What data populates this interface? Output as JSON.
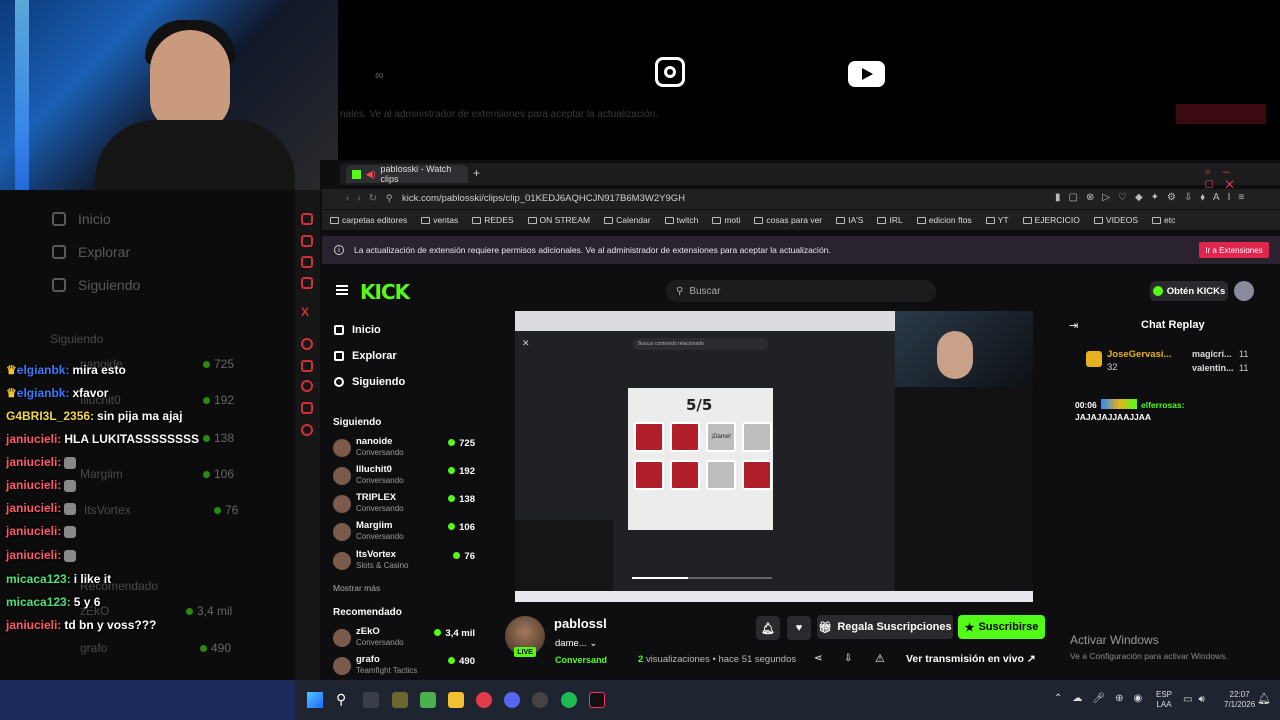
{
  "browser": {
    "tab_title": "pablosski - Watch clips",
    "url": "kick.com/pablosski/clips/clip_01KEDJ6AQHCJN917B6M3W2Y9GH",
    "bookmarks": [
      "carpetas editores",
      "ventas",
      "REDES",
      "ON STREAM",
      "Calendar",
      "twitch",
      "moti",
      "cosas para ver",
      "IA'S",
      "IRL",
      "edicion ftos",
      "YT",
      "EJERCICIO",
      "VIDEOS",
      "etc"
    ],
    "notice_text": "La actualización de extensión requiere permisos adicionales. Ve al administrador de extensiones para aceptar la actualización.",
    "notice_button": "Ir a Extensiones",
    "ghost_notice": "nales. Ve al administrador de extensiones para aceptar la actualización."
  },
  "kick": {
    "search_placeholder": "Buscar",
    "get_kicks": "Obtén KICKs",
    "nav": {
      "home": "Inicio",
      "explore": "Explorar",
      "following": "Siguiendo"
    },
    "following_heading": "Siguiendo",
    "following": [
      {
        "name": "nanoide",
        "status": "Conversando",
        "viewers": "725"
      },
      {
        "name": "Illuchit0",
        "status": "Conversando",
        "viewers": "192"
      },
      {
        "name": "TRIPLEX",
        "status": "Conversando",
        "viewers": "138"
      },
      {
        "name": "Margiim",
        "status": "Conversando",
        "viewers": "106"
      },
      {
        "name": "ItsVortex",
        "status": "Slots & Casino",
        "viewers": "76"
      }
    ],
    "show_more": "Mostrar más",
    "recommended_heading": "Recomendado",
    "recommended": [
      {
        "name": "zEkO",
        "status": "Conversando",
        "viewers": "3,4 mil"
      },
      {
        "name": "grafo",
        "status": "Teamfight Tactics",
        "viewers": "490"
      }
    ],
    "chat_replay_title": "Chat Replay",
    "replay_users": [
      {
        "name": "JoseGervasi...",
        "count": "32"
      },
      {
        "name": "magicri...",
        "count": "11"
      },
      {
        "name": "valentin...",
        "count": "11"
      }
    ],
    "replay_msg": {
      "time": "00:06",
      "user": "elferrosas:",
      "text": "JAJAJAJJAAJJAA"
    },
    "clip": {
      "channel": "pablossl",
      "title": "dame...",
      "category": "Conversand",
      "live_badge": "LIVE",
      "views_count": "2",
      "views_label": "visualizaciones",
      "ago": "hace 51 segundos",
      "gift_button": "Regala Suscripciones",
      "subscribe_button": "Suscribirse",
      "watch_live": "Ver transmisión en vivo"
    },
    "game": {
      "score": "5/5",
      "dame": "¡Dame!"
    },
    "video_search": "Buscar contenido relacionado"
  },
  "left_ghost": {
    "nav": [
      "Inicio",
      "Explorar",
      "Siguiendo"
    ],
    "following_heading": "Siguiendo",
    "items": [
      {
        "name": "nanoide",
        "viewers": "725"
      },
      {
        "name": "Illuchit0",
        "viewers": "192"
      },
      {
        "name": "TRIPLEX",
        "viewers": "138"
      },
      {
        "name": "Margiim",
        "viewers": "106"
      },
      {
        "name": "ItsVortex",
        "viewers": "76"
      },
      {
        "name": "Recomendado",
        "viewers": ""
      },
      {
        "name": "zEkO",
        "viewers": "3,4 mil"
      },
      {
        "name": "grafo",
        "viewers": "490"
      }
    ]
  },
  "chat_overlay": [
    {
      "user": "elgianbk:",
      "text": "mira esto",
      "color": "#3a7bff",
      "crown": true
    },
    {
      "user": "elgianbk:",
      "text": "xfavor",
      "color": "#3a7bff",
      "crown": true
    },
    {
      "user": "G4BRI3L_2356:",
      "text": "sin pija ma ajaj",
      "color": "#f3d548",
      "crown": false
    },
    {
      "user": "janiucieli:",
      "text": "HLA LUKITASSSSSSSS",
      "color": "#ff5a6a",
      "crown": false
    },
    {
      "user": "janiucieli:",
      "text": "",
      "color": "#ff5a6a",
      "crown": false
    },
    {
      "user": "janiucieli:",
      "text": "",
      "color": "#ff5a6a",
      "crown": false
    },
    {
      "user": "janiucieli:",
      "text": "",
      "color": "#ff5a6a",
      "crown": false
    },
    {
      "user": "janiucieli:",
      "text": "",
      "color": "#ff5a6a",
      "crown": false
    },
    {
      "user": "janiucieli:",
      "text": "",
      "color": "#ff5a6a",
      "crown": false
    },
    {
      "user": "micaca123:",
      "text": "i like it",
      "color": "#4fe07a",
      "crown": false
    },
    {
      "user": "micaca123:",
      "text": "5 y 6",
      "color": "#4fe07a",
      "crown": false
    },
    {
      "user": "janiucieli:",
      "text": "td bn y voss???",
      "color": "#ff5a6a",
      "crown": false
    }
  ],
  "windows": {
    "activate_title": "Activar Windows",
    "activate_sub": "Ve a Configuración para activar Windows.",
    "lang": "ESP",
    "lang2": "LAA",
    "time": "22:07",
    "date": "7/1/2026"
  },
  "colors": {
    "kick_green": "#53fc18",
    "notice_bg": "#2b2230",
    "ext_button": "#e0264d"
  }
}
